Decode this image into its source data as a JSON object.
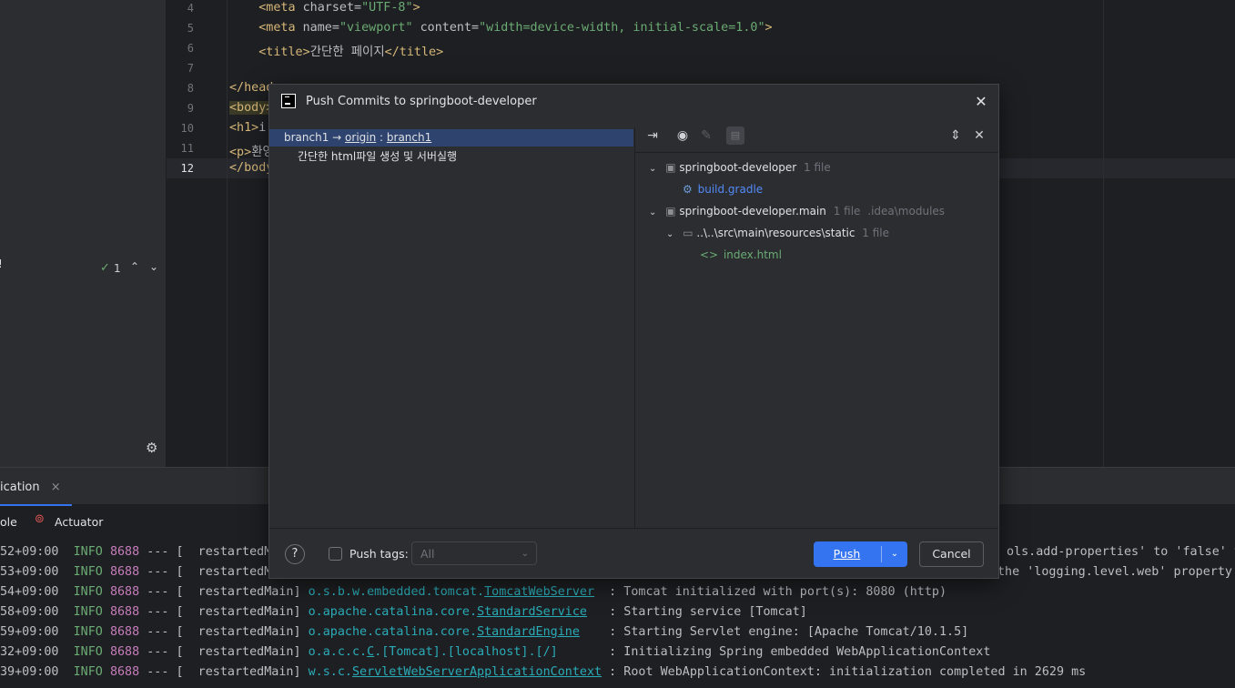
{
  "editor": {
    "lines": [
      {
        "num": "4",
        "pre": "    ",
        "open": "<meta",
        "a1": " charset=",
        "v1": "\"UTF-8\"",
        "a2": "",
        "v2": "",
        "a3": "",
        "v3": "",
        "close": ">"
      },
      {
        "num": "5",
        "pre": "    ",
        "open": "<meta",
        "a1": " name=",
        "v1": "\"viewport\"",
        "a2": " content=",
        "v2": "\"width=device-width, initial-scale=1.0\"",
        "a3": "",
        "v3": "",
        "close": ">"
      },
      {
        "num": "6",
        "pre": "    ",
        "open": "<title>",
        "text": "간단한 페이지",
        "close": "</title>"
      },
      {
        "num": "7"
      },
      {
        "num": "8",
        "open": "</head"
      },
      {
        "num": "9",
        "open": "<body>"
      },
      {
        "num": "10",
        "open": "<h1>",
        "text": "i"
      },
      {
        "num": "11",
        "open": "<p>",
        "text": "환영"
      },
      {
        "num": "12",
        "open": "</body"
      }
    ]
  },
  "left_panel": {
    "marker": "!",
    "check_count": "1",
    "check_icon": "checkmark-icon",
    "settings_icon": "gear-icon"
  },
  "bottom": {
    "tab_label": "ication",
    "tab_close": "×",
    "sub_left": "ole",
    "actuator_label": "Actuator",
    "actuator_icon": "actuator-icon",
    "log": [
      {
        "ts": "52+09:00",
        "level": "INFO",
        "pid": "8688",
        "sep": "--- [",
        "thread": "  restartedMain]",
        "logger": "",
        "msg": "ols.add-properties' to 'false' to"
      },
      {
        "ts": "53+09:00",
        "level": "INFO",
        "pid": "8688",
        "sep": "--- [",
        "thread": "  restartedMain]",
        "logger": "",
        "msg": "the 'logging.level.web' property t"
      },
      {
        "ts": "54+09:00",
        "level": "INFO",
        "pid": "8688",
        "sep": "--- [",
        "thread": "  restartedMain]",
        "logger_pre": "o.s.b.w.embedded.tomcat.",
        "logger_u": "TomcatWebServer",
        "pad": "  ",
        "msg": ": Tomcat initialized with port(s): 8080 (http)"
      },
      {
        "ts": "58+09:00",
        "level": "INFO",
        "pid": "8688",
        "sep": "--- [",
        "thread": "  restartedMain]",
        "logger_pre": "o.apache.catalina.core.",
        "logger_u": "StandardService",
        "pad": "   ",
        "msg": ": Starting service [Tomcat]"
      },
      {
        "ts": "59+09:00",
        "level": "INFO",
        "pid": "8688",
        "sep": "--- [",
        "thread": "  restartedMain]",
        "logger_pre": "o.apache.catalina.core.",
        "logger_u": "StandardEngine",
        "pad": "    ",
        "msg": ": Starting Servlet engine: [Apache Tomcat/10.1.5]"
      },
      {
        "ts": "32+09:00",
        "level": "INFO",
        "pid": "8688",
        "sep": "--- [",
        "thread": "  restartedMain]",
        "logger_pre": "o.a.c.c.",
        "logger_u": "C",
        "logger_post": ".[Tomcat].[localhost].[/]",
        "pad": "       ",
        "msg": ": Initializing Spring embedded WebApplicationContext"
      },
      {
        "ts": "39+09:00",
        "level": "INFO",
        "pid": "8688",
        "sep": "--- [",
        "thread": "  restartedMain]",
        "logger_pre": "w.s.c.",
        "logger_u": "ServletWebServerApplicationContext",
        "pad": " ",
        "msg": ": Root WebApplicationContext: initialization completed in 2629 ms"
      }
    ]
  },
  "dialog": {
    "title": "Push Commits to springboot-developer",
    "close_label": "✕",
    "branch": {
      "local": "branch1",
      "arrow": " → ",
      "remote": "origin",
      "colon": " : ",
      "target": "branch1"
    },
    "commit_message": "간단한 html파일 생성 및 서버실행",
    "toolbar_icons": [
      "merge-icon",
      "eye-icon",
      "edit-icon",
      "diff-icon",
      "expand-all-icon",
      "collapse-all-icon"
    ],
    "tree": {
      "node1": {
        "label": "springboot-developer",
        "count": "1 file"
      },
      "node1_file": "build.gradle",
      "node2": {
        "label": "springboot-developer.main",
        "count": "1 file",
        "path": ".idea\\modules"
      },
      "node2_dir": {
        "label": "..\\..\\src\\main\\resources\\static",
        "count": "1 file"
      },
      "node2_file": "index.html"
    },
    "footer": {
      "help": "?",
      "push_tags_label": "Push tags:",
      "tags_select_value": "All",
      "push_label": "Push",
      "cancel_label": "Cancel"
    },
    "colors": {
      "accent": "#3574f0",
      "selection": "#2e436e"
    }
  }
}
